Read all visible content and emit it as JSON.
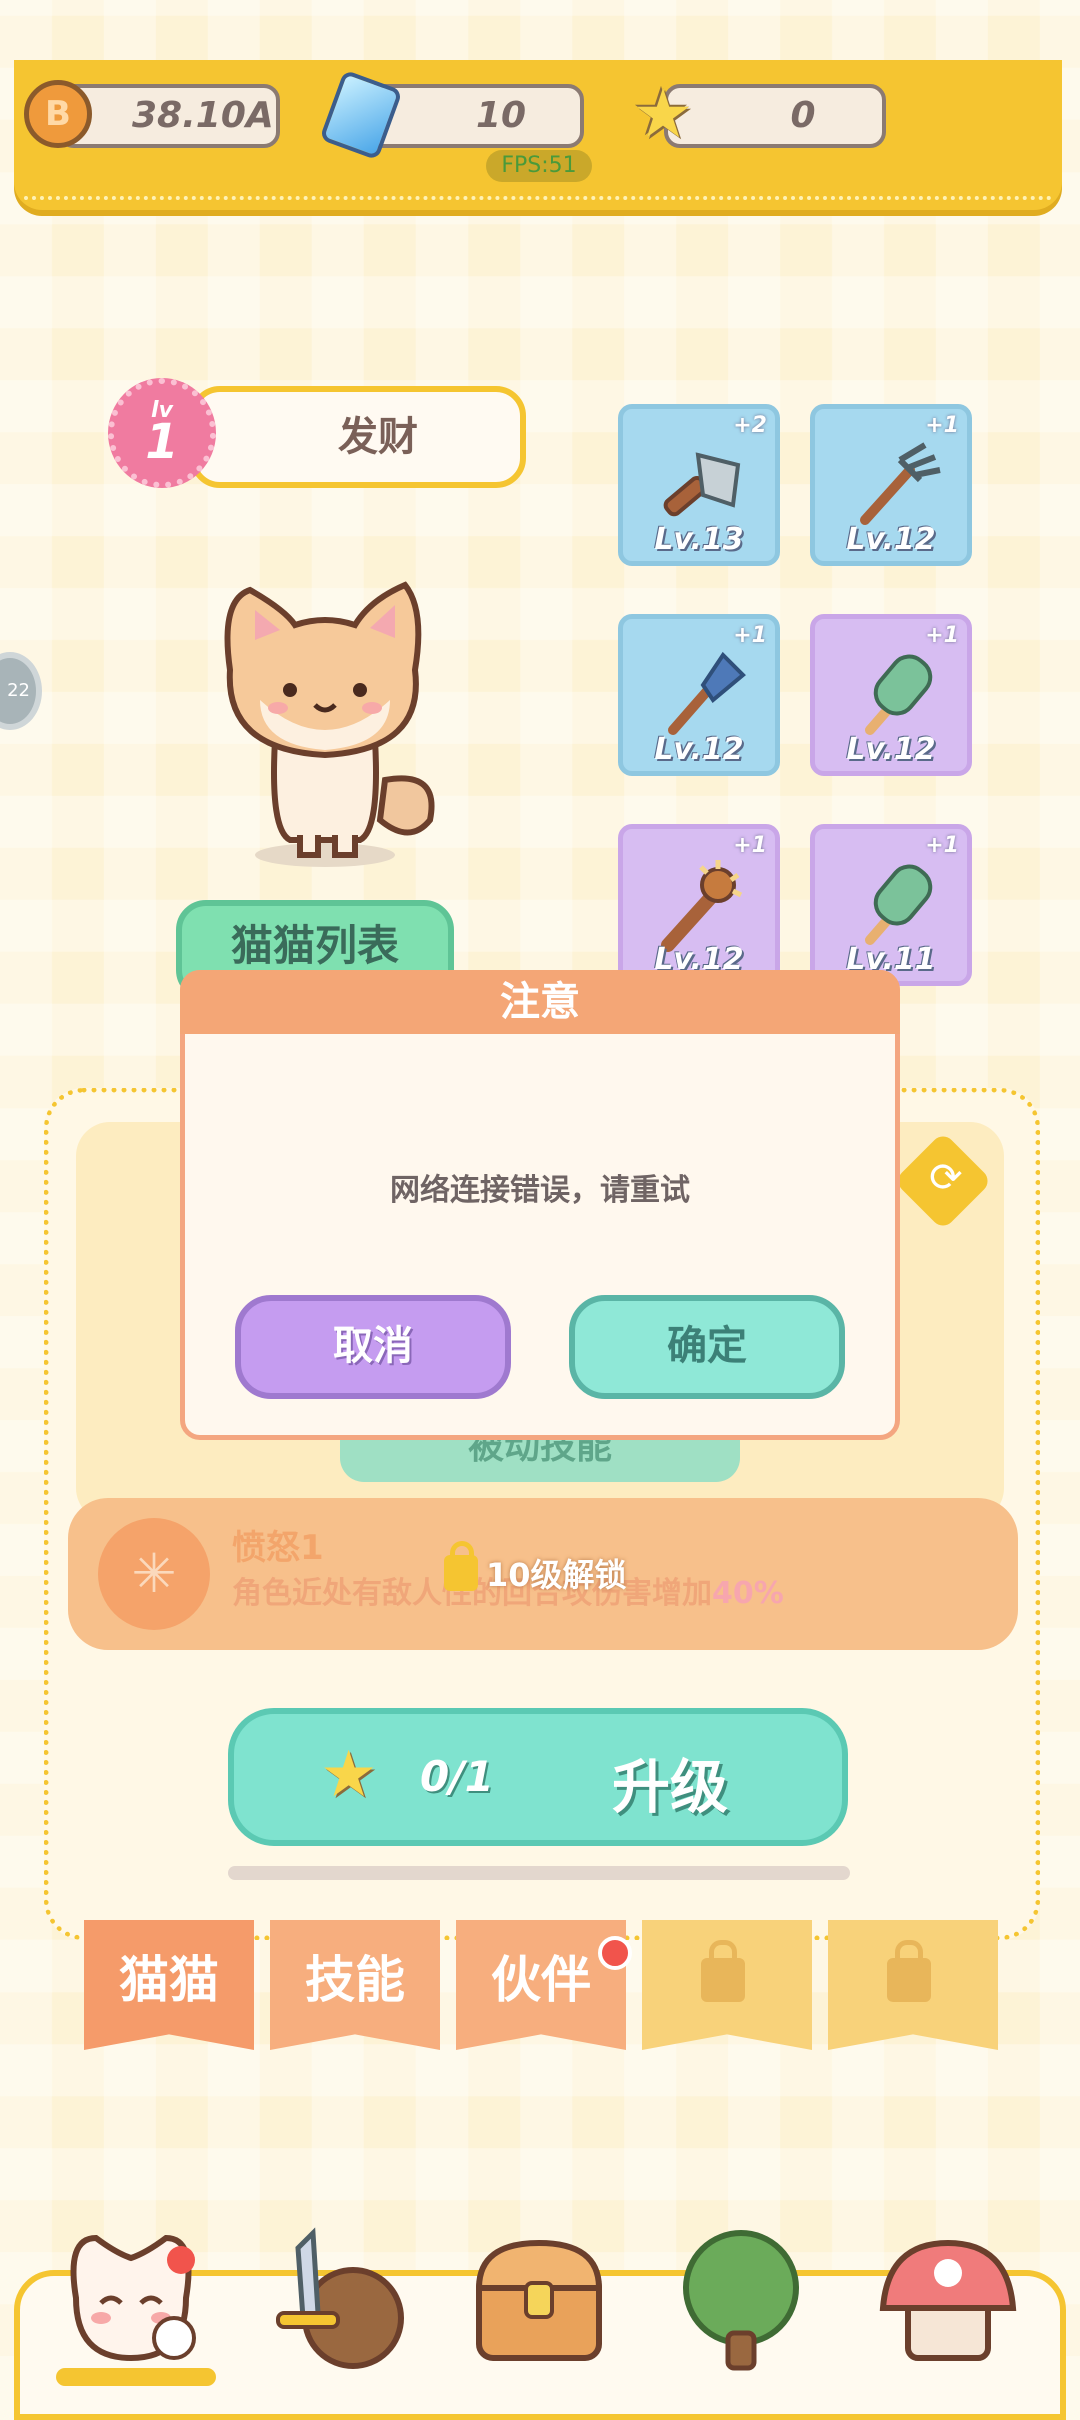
{
  "resources": {
    "coins": "38.10A",
    "gems": "10",
    "stars": "0",
    "fps": "FPS:51"
  },
  "character": {
    "level_prefix": "lv",
    "level": "1",
    "name": "发财"
  },
  "weapons": [
    {
      "level": "Lv.13",
      "bonus": "+2",
      "rarity": "blue",
      "icon": "cleaver-icon"
    },
    {
      "level": "Lv.12",
      "bonus": "+1",
      "rarity": "blue",
      "icon": "pitchfork-icon"
    },
    {
      "level": "Lv.12",
      "bonus": "+1",
      "rarity": "blue",
      "icon": "shovel-icon"
    },
    {
      "level": "Lv.12",
      "bonus": "+1",
      "rarity": "purple",
      "icon": "popsicle-icon"
    },
    {
      "level": "Lv.12",
      "bonus": "+1",
      "rarity": "purple",
      "icon": "spiked-club-icon"
    },
    {
      "level": "Lv.11",
      "bonus": "+1",
      "rarity": "purple",
      "icon": "popsicle-icon"
    }
  ],
  "cat_list_button": "猫猫列表",
  "passive_tab": "被动技能",
  "skill": {
    "name": "愤怒1",
    "desc": "角色近处有敌人",
    "desc2": "性的回合攻伤害增加",
    "percent": "40%",
    "lock_text": "10级解锁"
  },
  "upgrade": {
    "count": "0/1",
    "label": "升级",
    "progress": 0.0
  },
  "tabs": [
    {
      "label": "猫猫",
      "state": "active"
    },
    {
      "label": "技能",
      "state": "normal"
    },
    {
      "label": "伙伴",
      "state": "normal",
      "badge": true
    },
    {
      "label": "",
      "state": "locked"
    },
    {
      "label": "",
      "state": "locked"
    }
  ],
  "modal": {
    "title": "注意",
    "message": "网络连接错误，请重试",
    "cancel": "取消",
    "confirm": "确定"
  },
  "side_disc_label": "22",
  "colors": {
    "accent_yellow": "#f5c531",
    "mint": "#7fe3cf",
    "purple": "#c59cf0",
    "orange": "#f4a676"
  }
}
